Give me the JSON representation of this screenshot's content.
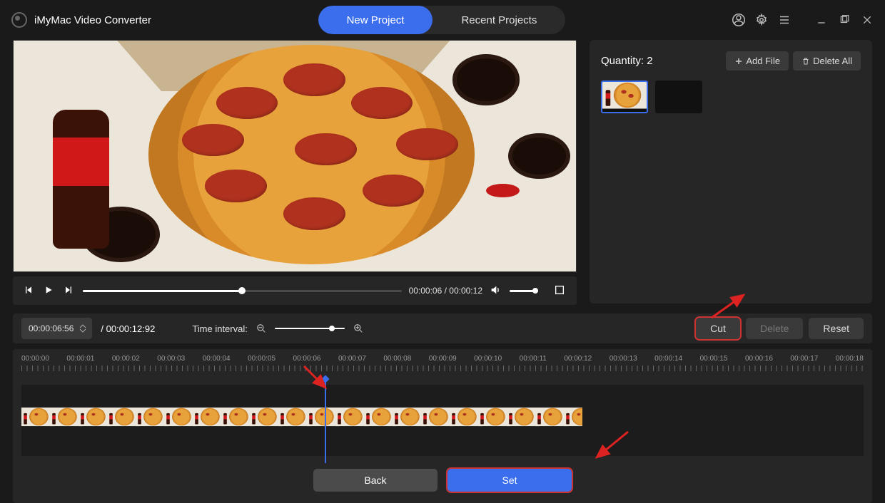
{
  "app": {
    "title": "iMyMac Video Converter"
  },
  "tabs": {
    "new_project": "New Project",
    "recent_projects": "Recent Projects"
  },
  "playbar": {
    "current": "00:00:06",
    "duration": "00:00:12",
    "combined": "00:00:06 / 00:00:12"
  },
  "side": {
    "quantity_label": "Quantity:",
    "quantity_value": "2",
    "add_file": "Add File",
    "delete_all": "Delete All"
  },
  "editor": {
    "timecode": "00:00:06:56",
    "duration_full": "/ 00:00:12:92",
    "time_interval_label": "Time interval:",
    "cut": "Cut",
    "delete": "Delete",
    "reset": "Reset"
  },
  "ruler": {
    "ticks": [
      "00:00:00",
      "00:00:01",
      "00:00:02",
      "00:00:03",
      "00:00:04",
      "00:00:05",
      "00:00:06",
      "00:00:07",
      "00:00:08",
      "00:00:09",
      "00:00:10",
      "00:00:11",
      "00:00:12",
      "00:00:13",
      "00:00:14",
      "00:00:15",
      "00:00:16",
      "00:00:17",
      "00:00:18"
    ]
  },
  "bottom": {
    "back": "Back",
    "set": "Set"
  }
}
